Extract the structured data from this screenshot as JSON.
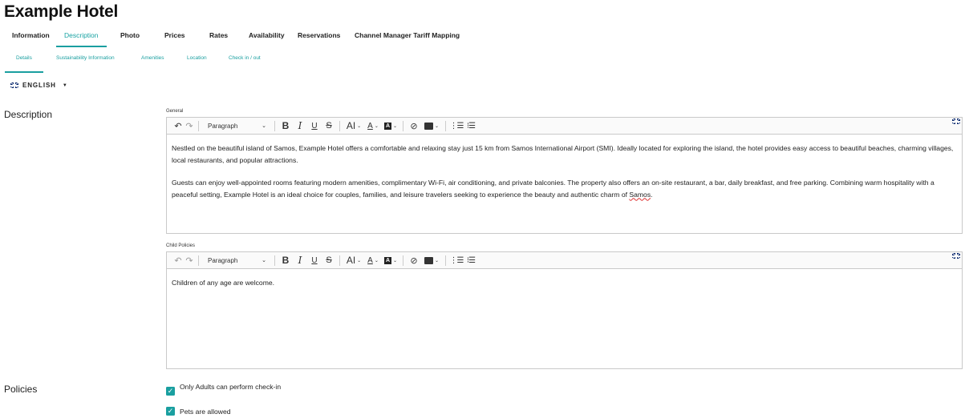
{
  "title": "Example Hotel",
  "main_tabs": [
    {
      "label": "Information"
    },
    {
      "label": "Description",
      "active": true
    },
    {
      "label": "Photo"
    },
    {
      "label": "Prices"
    },
    {
      "label": "Rates"
    },
    {
      "label": "Availability"
    },
    {
      "label": "Reservations"
    },
    {
      "label": "Channel Manager Tariff Mapping"
    }
  ],
  "sub_tabs": [
    {
      "label": "Details",
      "active": true
    },
    {
      "label": "Sustainability Information"
    },
    {
      "label": "Amenities"
    },
    {
      "label": "Location"
    },
    {
      "label": "Check in / out"
    }
  ],
  "language": {
    "label": "ENGLISH",
    "icon": "uk-flag-icon"
  },
  "sections": {
    "description": "Description",
    "policies": "Policies"
  },
  "editors": {
    "general": {
      "label": "General",
      "paragraph_style": "Paragraph",
      "paragraphs": [
        "Nestled on the beautiful island of Samos, Example Hotel offers a comfortable and relaxing stay just 15 km from Samos International Airport (SMI). Ideally located for exploring the island, the hotel provides easy access to beautiful beaches, charming villages, local restaurants, and popular attractions.",
        "Guests can enjoy well-appointed rooms featuring modern amenities, complimentary Wi-Fi, air conditioning, and private balconies. The property also offers an on-site restaurant, a bar, daily breakfast, and free parking. Combining warm hospitality with a peaceful setting, Example Hotel is an ideal choice for couples, families, and leisure travelers seeking to experience the beauty and authentic charm of Samos."
      ]
    },
    "child_policies": {
      "label": "Child Policies",
      "paragraph_style": "Paragraph",
      "paragraphs": [
        "Children of any age are welcome."
      ]
    }
  },
  "policies": [
    {
      "label": "Only Adults can perform check-in",
      "checked": true
    },
    {
      "label": "Pets are allowed",
      "checked": true
    }
  ],
  "colors": {
    "accent": "#1a9fa0"
  }
}
